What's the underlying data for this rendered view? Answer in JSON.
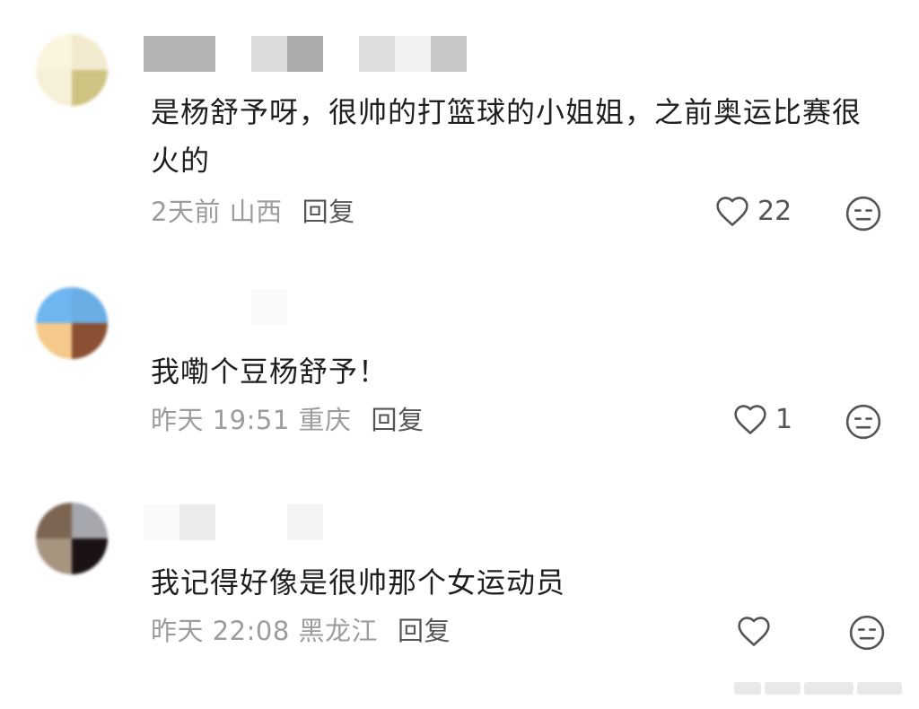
{
  "comments": [
    {
      "text": "是杨舒予呀，很帅的打篮球的小姐姐，之前奥运比赛很火的",
      "time_location": "2天前 山西",
      "reply_label": "回复",
      "like_count": "22"
    },
    {
      "text": "我嘞个豆杨舒予！",
      "time_location": "昨天 19:51 重庆",
      "reply_label": "回复",
      "like_count": "1"
    },
    {
      "text": "我记得好像是很帅那个女运动员",
      "time_location": "昨天 22:08 黑龙江",
      "reply_label": "回复",
      "like_count": ""
    }
  ],
  "icons": {
    "like": "heart-outline-icon",
    "dislike": "meh-face-icon"
  },
  "colors": {
    "text": "#1f1f1f",
    "meta": "#9c9c9c",
    "action": "#555555"
  }
}
